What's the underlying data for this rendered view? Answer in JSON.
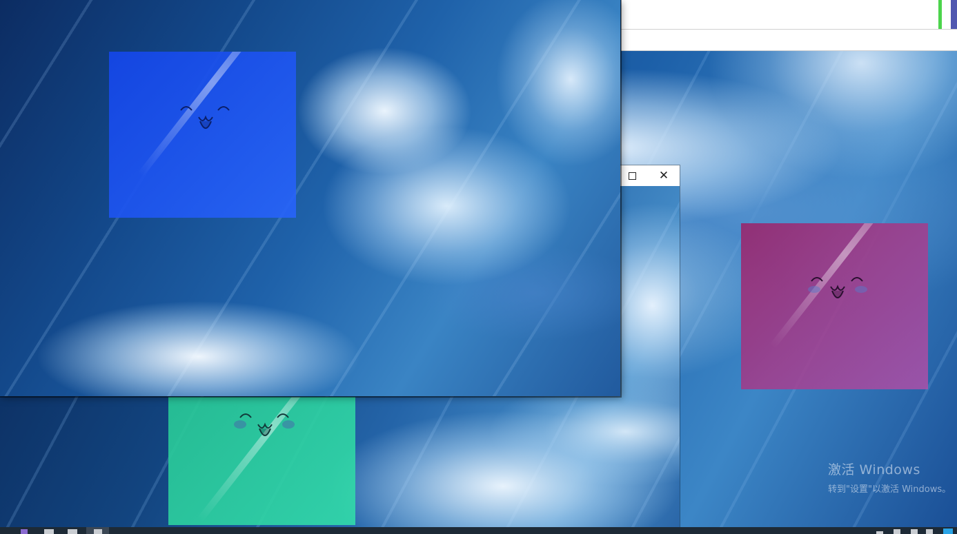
{
  "desktop": {
    "watermark": {
      "title": "激活 Windows",
      "subtitle": "转到\"设置\"以激活 Windows。"
    }
  },
  "windows": {
    "top": {
      "accent_color": "#4cd44c",
      "accent_bar_color": "#5058b0"
    },
    "middle": {
      "maximize_icon": "maximize-icon",
      "close_icon": "close-icon",
      "close_glyph": "✕"
    },
    "main": {}
  },
  "squares": [
    {
      "name": "blue-square",
      "color": "#1446e6"
    },
    {
      "name": "green-square",
      "color": "#28c896"
    },
    {
      "name": "pink-square",
      "color": "#96286e"
    }
  ],
  "taskbar": {
    "background": "#1d2a36",
    "accent": "#2aa4e6"
  }
}
